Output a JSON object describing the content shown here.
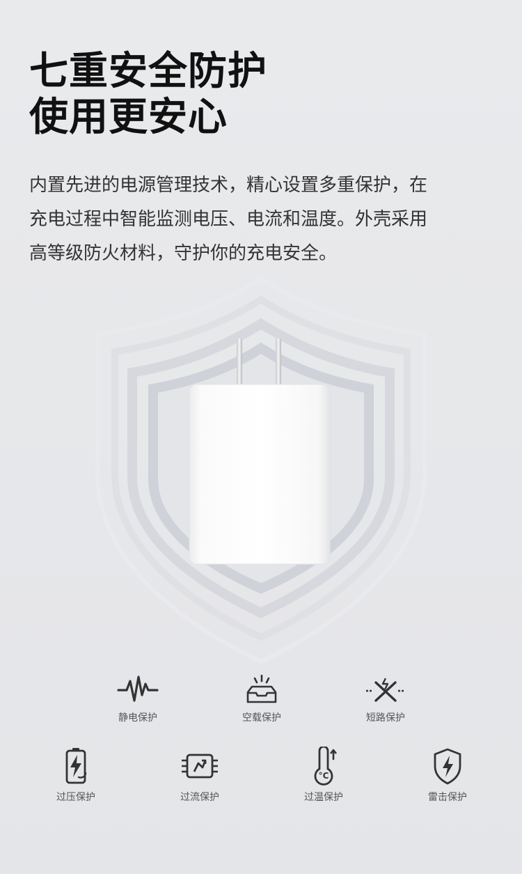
{
  "headline": {
    "line1": "七重安全防护",
    "line2": "使用更安心"
  },
  "description": {
    "line1": "内置先进的电源管理技术，精心设置多重保护，在",
    "line2": "充电过程中智能监测电压、电流和温度。外壳采用",
    "line3": "高等级防火材料，守护你的充电安全。"
  },
  "colors": {
    "background": "#e5e6e9",
    "headline": "#111111",
    "text": "#333333",
    "icon": "#333333",
    "label": "#555555"
  },
  "features": [
    {
      "label": "静电保护",
      "icon": "pulse-wave-icon"
    },
    {
      "label": "空载保护",
      "icon": "empty-tray-icon"
    },
    {
      "label": "短路保护",
      "icon": "short-circuit-icon"
    },
    {
      "label": "过压保护",
      "icon": "battery-bolt-icon"
    },
    {
      "label": "过流保护",
      "icon": "chip-current-icon"
    },
    {
      "label": "过温保护",
      "icon": "thermometer-icon"
    },
    {
      "label": "雷击保护",
      "icon": "shield-bolt-icon"
    }
  ]
}
